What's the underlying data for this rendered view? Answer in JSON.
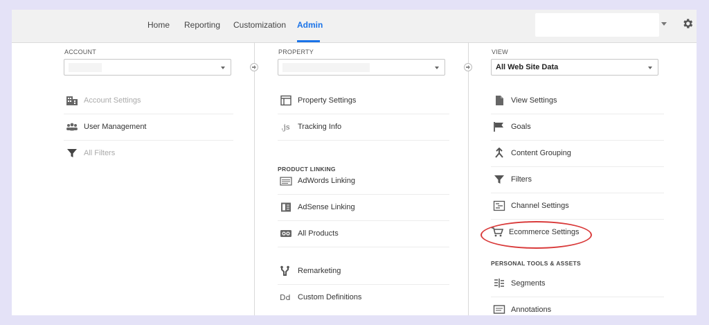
{
  "nav": {
    "home": "Home",
    "reporting": "Reporting",
    "customization": "Customization",
    "admin": "Admin"
  },
  "account": {
    "header": "ACCOUNT",
    "items": [
      {
        "label": "Account Settings",
        "icon": "building-icon",
        "disabled": true
      },
      {
        "label": "User Management",
        "icon": "users-icon",
        "disabled": false
      },
      {
        "label": "All Filters",
        "icon": "filter-icon",
        "disabled": true
      }
    ]
  },
  "property": {
    "header": "PROPERTY",
    "items": [
      {
        "label": "Property Settings",
        "icon": "window-icon"
      },
      {
        "label": "Tracking Info",
        "icon": "js-icon"
      }
    ],
    "product_linking_header": "PRODUCT LINKING",
    "linking_items": [
      {
        "label": "AdWords Linking",
        "icon": "adwords-icon"
      },
      {
        "label": "AdSense Linking",
        "icon": "adsense-icon"
      },
      {
        "label": "All Products",
        "icon": "products-icon"
      }
    ],
    "extra_items": [
      {
        "label": "Remarketing",
        "icon": "remarketing-icon"
      },
      {
        "label": "Custom Definitions",
        "icon": "dd-icon"
      }
    ]
  },
  "view": {
    "header": "VIEW",
    "selected": "All Web Site Data",
    "items": [
      {
        "label": "View Settings",
        "icon": "document-icon"
      },
      {
        "label": "Goals",
        "icon": "flag-icon"
      },
      {
        "label": "Content Grouping",
        "icon": "grouping-icon"
      },
      {
        "label": "Filters",
        "icon": "filter-icon"
      },
      {
        "label": "Channel Settings",
        "icon": "channel-icon"
      },
      {
        "label": "Ecommerce Settings",
        "icon": "cart-icon"
      }
    ],
    "personal_header": "PERSONAL TOOLS & ASSETS",
    "personal_items": [
      {
        "label": "Segments",
        "icon": "segments-icon"
      },
      {
        "label": "Annotations",
        "icon": "annotations-icon"
      }
    ]
  },
  "colors": {
    "accent": "#1a73e8",
    "highlight_circle": "#d93a3a"
  }
}
